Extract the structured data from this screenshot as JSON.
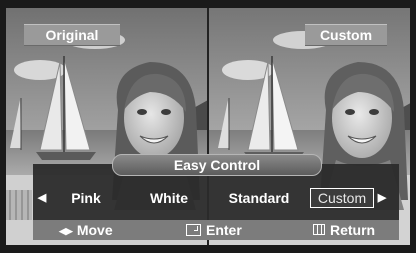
{
  "comparison": {
    "left_label": "Original",
    "right_label": "Custom"
  },
  "osd": {
    "title": "Easy Control",
    "options": [
      "Pink",
      "White",
      "Standard",
      "Custom"
    ],
    "selected": "Custom",
    "prev_icon": "arrow-left-icon",
    "next_icon": "arrow-right-icon"
  },
  "help": {
    "move_label": "Move",
    "enter_label": "Enter",
    "return_label": "Return"
  },
  "colors": {
    "label_background": "#9a9a9a",
    "osd_band": "#2b2b2b",
    "help_bar": "#7c7c7c",
    "text": "#ffffff"
  }
}
